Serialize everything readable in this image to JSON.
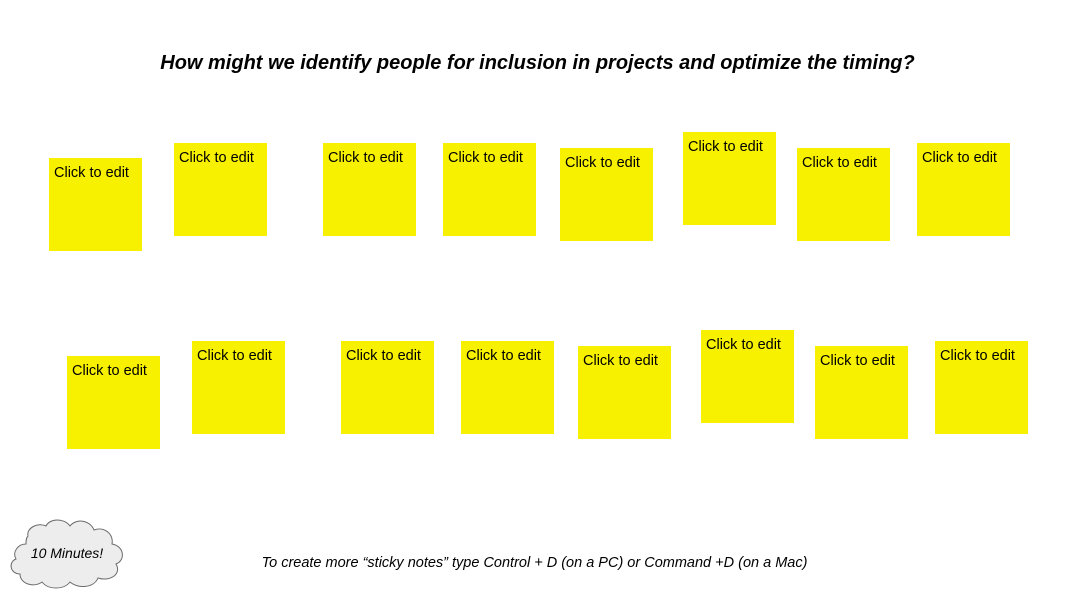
{
  "title": "How might we identify people for inclusion in projects and optimize the timing?",
  "sticky_color": "#f7f100",
  "sticky_notes": [
    {
      "label": "Click to edit"
    },
    {
      "label": "Click to edit"
    },
    {
      "label": "Click to edit"
    },
    {
      "label": "Click to edit"
    },
    {
      "label": "Click to edit"
    },
    {
      "label": "Click to edit"
    },
    {
      "label": "Click to edit"
    },
    {
      "label": "Click to edit"
    },
    {
      "label": "Click to edit"
    },
    {
      "label": "Click to edit"
    },
    {
      "label": "Click to edit"
    },
    {
      "label": "Click to edit"
    },
    {
      "label": "Click to edit"
    },
    {
      "label": "Click to edit"
    },
    {
      "label": "Click to edit"
    },
    {
      "label": "Click to edit"
    }
  ],
  "timer_cloud": {
    "label": "10 Minutes!"
  },
  "hint": "To create more “sticky notes” type Control + D (on a PC) or Command +D (on a Mac)"
}
